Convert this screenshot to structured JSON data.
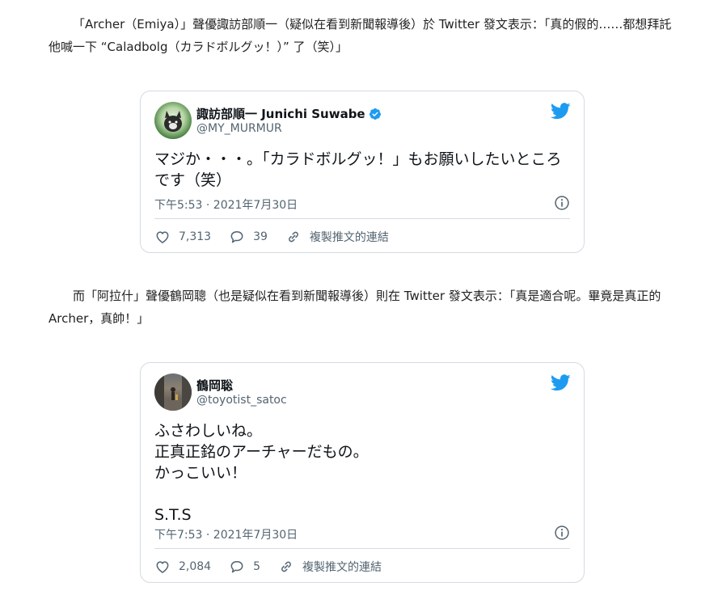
{
  "article": {
    "paragraph1": "「Archer（Emiya）」聲優諏訪部順一（疑似在看到新聞報導後）於 Twitter 發文表示：「真的假的……都想拜託他喊一下 “Caladbolg（カラドボルグッ！）” 了（笑）」",
    "paragraph2": "而「阿拉什」聲優鶴岡聰（也是疑似在看到新聞報導後）則在 Twitter 發文表示：「真是適合呢。畢竟是真正的 Archer，真帥！」"
  },
  "tweets": [
    {
      "display_name": "諏訪部順一 Junichi Suwabe",
      "handle": "@MY_MURMUR",
      "verified": true,
      "text": "マジか・・・。「カラドボルグッ！」もお願いしたいところです（笑）",
      "timestamp": "下午5:53 · 2021年7月30日",
      "likes": "7,313",
      "replies": "39",
      "copy_link_label": "複製推文的連結",
      "avatar_icon": "dog-avatar"
    },
    {
      "display_name": "鶴岡聡",
      "handle": "@toyotist_satoc",
      "verified": false,
      "text": "ふさわしいね。\n正真正銘のアーチャーだもの。\nかっこいい！\n\nS.T.S",
      "timestamp": "下午7:53 · 2021年7月30日",
      "likes": "2,084",
      "replies": "5",
      "copy_link_label": "複製推文的連結",
      "avatar_icon": "person-street-avatar"
    }
  ],
  "colors": {
    "twitter_blue": "#1d9bf0",
    "secondary_text": "#536471",
    "border": "#d4dbe1"
  },
  "icons": [
    "twitter-bird-icon",
    "verified-badge-icon",
    "info-icon",
    "heart-icon",
    "reply-icon",
    "link-icon"
  ]
}
